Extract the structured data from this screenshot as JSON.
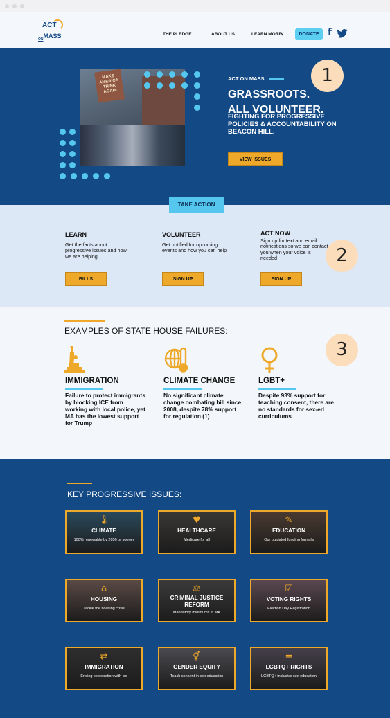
{
  "nav": {
    "logo_top": "ACT",
    "logo_on": "ON",
    "logo_bottom": "MASS",
    "links": [
      "THE PLEDGE",
      "ABOUT US",
      "LEARN MORE"
    ],
    "learn_more_chevron": "∨",
    "donate": "DONATE",
    "facebook": "f",
    "twitter": "🐦"
  },
  "hero": {
    "photo_sign": "MAKE AMERICA THINK AGAIN",
    "kicker": "ACT ON MASS",
    "heading_line1": "GRASSROOTS.",
    "heading_line2": "ALL VOLUNTEER.",
    "subheading": "FIGHTING FOR PROGRESSIVE POLICIES & ACCOUNTABILITY ON BEACON HILL.",
    "button": "VIEW ISSUES"
  },
  "markers": [
    "1",
    "2",
    "3"
  ],
  "take_action": {
    "tab": "TAKE ACTION",
    "columns": [
      {
        "title": "LEARN",
        "text": "Get the facts about progressive issues and how we are helping",
        "button": "BILLS"
      },
      {
        "title": "VOLUNTEER",
        "text": "Get notified for upcoming events and how you can help",
        "button": "SIGN UP"
      },
      {
        "title": "ACT NOW",
        "text": "Sign up for text and email notifications so we can contact you when your voice is needed",
        "button": "SIGN UP"
      }
    ]
  },
  "failures": {
    "title": "EXAMPLES OF STATE HOUSE FAILURES:",
    "items": [
      {
        "icon": "statue-of-liberty-icon",
        "title": "IMMIGRATION",
        "text": "Failure to protect immigrants by blocking ICE from working with local police, yet MA has the lowest support for Trump"
      },
      {
        "icon": "globe-thermometer-icon",
        "title": "CLIMATE CHANGE",
        "text": "No significant climate change combating bill since 2008, despite 78% support for regulation (1)"
      },
      {
        "icon": "female-symbol-icon",
        "title": "LGBT+",
        "text": "Despite 93% support for teaching consent, there are no standards for sex-ed curriculums"
      }
    ]
  },
  "issues": {
    "title": "KEY PROGRESSIVE ISSUES:",
    "cards": [
      {
        "icon": "🌡",
        "title": "CLIMATE",
        "sub": "100% renewable by 2050 or sooner",
        "bg": "#2a4a5c"
      },
      {
        "icon": "♥",
        "title": "HEALTHCARE",
        "sub": "Medicare for all",
        "bg": "#3a3835"
      },
      {
        "icon": "✎",
        "title": "EDUCATION",
        "sub": "Our outdated funding formula",
        "bg": "#4a3a30"
      },
      {
        "icon": "⌂",
        "title": "HOUSING",
        "sub": "Tackle the housing crisis",
        "bg": "#5a4a45"
      },
      {
        "icon": "⚖",
        "title": "CRIMINAL JUSTICE REFORM",
        "sub": "Mandatory minimums in MA",
        "bg": "#3a3a3a"
      },
      {
        "icon": "☑",
        "title": "VOTING RIGHTS",
        "sub": "Election Day Registration",
        "bg": "#5a4850"
      },
      {
        "icon": "⇄",
        "title": "IMMIGRATION",
        "sub": "Ending cooperation with ice",
        "bg": "#2e2e2e"
      },
      {
        "icon": "⚥",
        "title": "GENDER EQUITY",
        "sub": "Teach consent in sex education",
        "bg": "#4a4a50"
      },
      {
        "icon": "=",
        "title": "LGBTQ+ RIGHTS",
        "sub": "LGBTQ+ inclusive sex education",
        "bg": "#45404a"
      }
    ]
  },
  "colors": {
    "navy": "#134a86",
    "cyan": "#55c7ef",
    "orange": "#eea92a",
    "light_blue_bg": "#dde8f7",
    "pale_bg": "#f3f7fc",
    "peach_marker": "#fbdcbb"
  }
}
